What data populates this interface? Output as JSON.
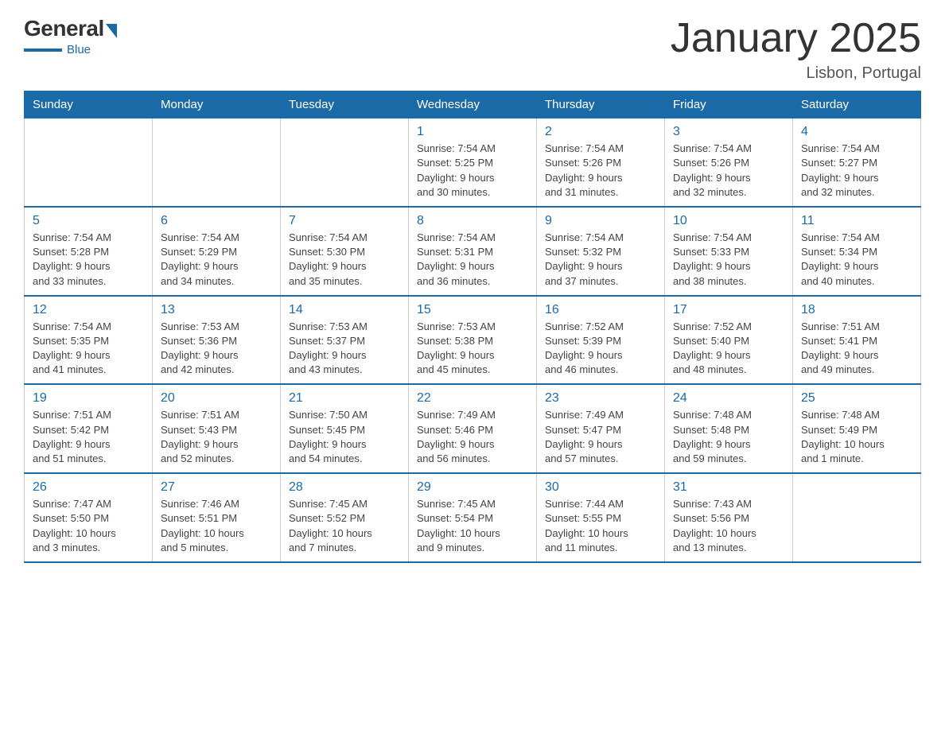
{
  "logo": {
    "general": "General",
    "blue": "Blue",
    "bottom": "Blue"
  },
  "title": "January 2025",
  "subtitle": "Lisbon, Portugal",
  "weekdays": [
    "Sunday",
    "Monday",
    "Tuesday",
    "Wednesday",
    "Thursday",
    "Friday",
    "Saturday"
  ],
  "weeks": [
    [
      {
        "day": "",
        "info": ""
      },
      {
        "day": "",
        "info": ""
      },
      {
        "day": "",
        "info": ""
      },
      {
        "day": "1",
        "info": "Sunrise: 7:54 AM\nSunset: 5:25 PM\nDaylight: 9 hours\nand 30 minutes."
      },
      {
        "day": "2",
        "info": "Sunrise: 7:54 AM\nSunset: 5:26 PM\nDaylight: 9 hours\nand 31 minutes."
      },
      {
        "day": "3",
        "info": "Sunrise: 7:54 AM\nSunset: 5:26 PM\nDaylight: 9 hours\nand 32 minutes."
      },
      {
        "day": "4",
        "info": "Sunrise: 7:54 AM\nSunset: 5:27 PM\nDaylight: 9 hours\nand 32 minutes."
      }
    ],
    [
      {
        "day": "5",
        "info": "Sunrise: 7:54 AM\nSunset: 5:28 PM\nDaylight: 9 hours\nand 33 minutes."
      },
      {
        "day": "6",
        "info": "Sunrise: 7:54 AM\nSunset: 5:29 PM\nDaylight: 9 hours\nand 34 minutes."
      },
      {
        "day": "7",
        "info": "Sunrise: 7:54 AM\nSunset: 5:30 PM\nDaylight: 9 hours\nand 35 minutes."
      },
      {
        "day": "8",
        "info": "Sunrise: 7:54 AM\nSunset: 5:31 PM\nDaylight: 9 hours\nand 36 minutes."
      },
      {
        "day": "9",
        "info": "Sunrise: 7:54 AM\nSunset: 5:32 PM\nDaylight: 9 hours\nand 37 minutes."
      },
      {
        "day": "10",
        "info": "Sunrise: 7:54 AM\nSunset: 5:33 PM\nDaylight: 9 hours\nand 38 minutes."
      },
      {
        "day": "11",
        "info": "Sunrise: 7:54 AM\nSunset: 5:34 PM\nDaylight: 9 hours\nand 40 minutes."
      }
    ],
    [
      {
        "day": "12",
        "info": "Sunrise: 7:54 AM\nSunset: 5:35 PM\nDaylight: 9 hours\nand 41 minutes."
      },
      {
        "day": "13",
        "info": "Sunrise: 7:53 AM\nSunset: 5:36 PM\nDaylight: 9 hours\nand 42 minutes."
      },
      {
        "day": "14",
        "info": "Sunrise: 7:53 AM\nSunset: 5:37 PM\nDaylight: 9 hours\nand 43 minutes."
      },
      {
        "day": "15",
        "info": "Sunrise: 7:53 AM\nSunset: 5:38 PM\nDaylight: 9 hours\nand 45 minutes."
      },
      {
        "day": "16",
        "info": "Sunrise: 7:52 AM\nSunset: 5:39 PM\nDaylight: 9 hours\nand 46 minutes."
      },
      {
        "day": "17",
        "info": "Sunrise: 7:52 AM\nSunset: 5:40 PM\nDaylight: 9 hours\nand 48 minutes."
      },
      {
        "day": "18",
        "info": "Sunrise: 7:51 AM\nSunset: 5:41 PM\nDaylight: 9 hours\nand 49 minutes."
      }
    ],
    [
      {
        "day": "19",
        "info": "Sunrise: 7:51 AM\nSunset: 5:42 PM\nDaylight: 9 hours\nand 51 minutes."
      },
      {
        "day": "20",
        "info": "Sunrise: 7:51 AM\nSunset: 5:43 PM\nDaylight: 9 hours\nand 52 minutes."
      },
      {
        "day": "21",
        "info": "Sunrise: 7:50 AM\nSunset: 5:45 PM\nDaylight: 9 hours\nand 54 minutes."
      },
      {
        "day": "22",
        "info": "Sunrise: 7:49 AM\nSunset: 5:46 PM\nDaylight: 9 hours\nand 56 minutes."
      },
      {
        "day": "23",
        "info": "Sunrise: 7:49 AM\nSunset: 5:47 PM\nDaylight: 9 hours\nand 57 minutes."
      },
      {
        "day": "24",
        "info": "Sunrise: 7:48 AM\nSunset: 5:48 PM\nDaylight: 9 hours\nand 59 minutes."
      },
      {
        "day": "25",
        "info": "Sunrise: 7:48 AM\nSunset: 5:49 PM\nDaylight: 10 hours\nand 1 minute."
      }
    ],
    [
      {
        "day": "26",
        "info": "Sunrise: 7:47 AM\nSunset: 5:50 PM\nDaylight: 10 hours\nand 3 minutes."
      },
      {
        "day": "27",
        "info": "Sunrise: 7:46 AM\nSunset: 5:51 PM\nDaylight: 10 hours\nand 5 minutes."
      },
      {
        "day": "28",
        "info": "Sunrise: 7:45 AM\nSunset: 5:52 PM\nDaylight: 10 hours\nand 7 minutes."
      },
      {
        "day": "29",
        "info": "Sunrise: 7:45 AM\nSunset: 5:54 PM\nDaylight: 10 hours\nand 9 minutes."
      },
      {
        "day": "30",
        "info": "Sunrise: 7:44 AM\nSunset: 5:55 PM\nDaylight: 10 hours\nand 11 minutes."
      },
      {
        "day": "31",
        "info": "Sunrise: 7:43 AM\nSunset: 5:56 PM\nDaylight: 10 hours\nand 13 minutes."
      },
      {
        "day": "",
        "info": ""
      }
    ]
  ]
}
